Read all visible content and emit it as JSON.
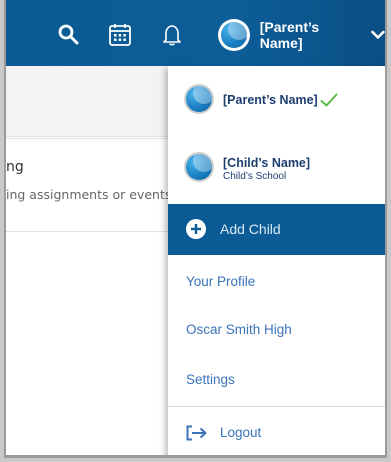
{
  "header": {
    "user_name": "[Parent’s Name]",
    "search_icon": "search-icon",
    "calendar_icon": "calendar-icon",
    "notifications_icon": "bell-icon",
    "dropdown_icon": "chevron-down-icon"
  },
  "background": {
    "card_title": "ng",
    "card_text": "ing assignments or events"
  },
  "dropdown": {
    "accounts": [
      {
        "name": "[Parent’s Name]",
        "selected": true
      },
      {
        "name": "[Child’s Name]",
        "school": "Child’s School"
      }
    ],
    "add_child_label": "Add Child",
    "links": [
      "Your Profile",
      "Oscar Smith High",
      "Settings"
    ],
    "logout_label": "Logout"
  },
  "colors": {
    "brand_blue": "#0b5c96",
    "link_blue": "#3b73b9",
    "check_green": "#5ab947"
  }
}
